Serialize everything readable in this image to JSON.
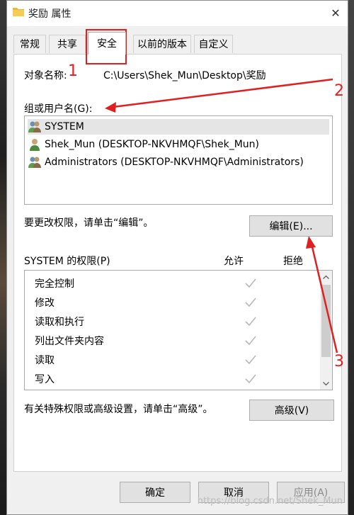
{
  "window": {
    "title": "奖励 属性",
    "close_glyph": "✕"
  },
  "tabs": [
    {
      "label": "常规"
    },
    {
      "label": "共享"
    },
    {
      "label": "安全"
    },
    {
      "label": "以前的版本"
    },
    {
      "label": "自定义"
    }
  ],
  "security": {
    "object_label": "对象名称:",
    "object_path": "C:\\Users\\Shek_Mun\\Desktop\\奖励",
    "group_label": "组或用户名(G):",
    "users": [
      {
        "name": "SYSTEM"
      },
      {
        "name": "Shek_Mun (DESKTOP-NKVHMQF\\Shek_Mun)"
      },
      {
        "name": "Administrators (DESKTOP-NKVHMQF\\Administrators)"
      }
    ],
    "edit_hint": "要更改权限，请单击“编辑”。",
    "edit_button": "编辑(E)...",
    "perm_header": "SYSTEM 的权限(P)",
    "allow_header": "允许",
    "deny_header": "拒绝",
    "permissions": [
      {
        "label": "完全控制"
      },
      {
        "label": "修改"
      },
      {
        "label": "读取和执行"
      },
      {
        "label": "列出文件夹内容"
      },
      {
        "label": "读取"
      },
      {
        "label": "写入"
      }
    ],
    "advanced_hint": "有关特殊权限或高级设置，请单击“高级”。",
    "advanced_button": "高级(V)"
  },
  "buttons": {
    "ok": "确定",
    "cancel": "取消",
    "apply": "应用(A)"
  },
  "annotations": {
    "n1": "1",
    "n2": "2",
    "n3": "3",
    "color": "#e02020"
  },
  "watermark": "https://blog.csdn.net/Shek_Mun"
}
